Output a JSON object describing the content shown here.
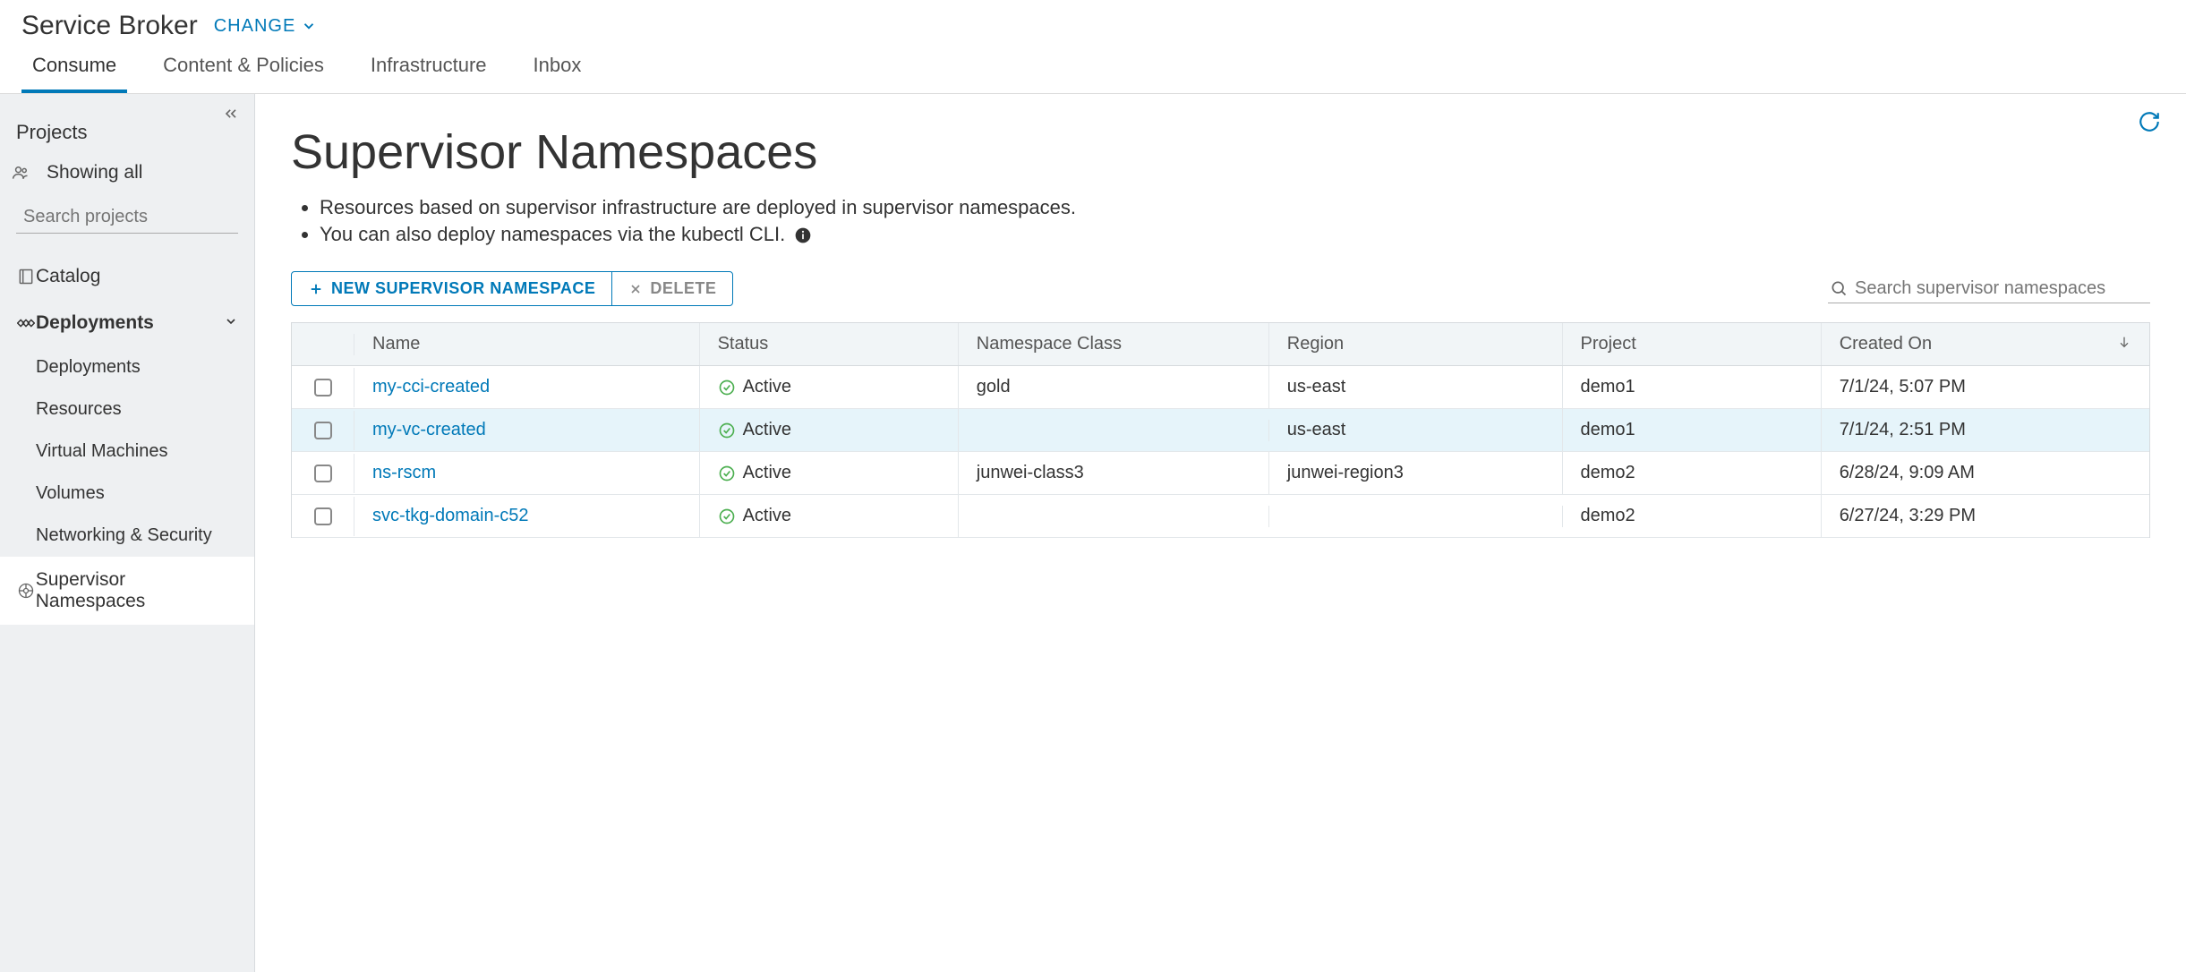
{
  "header": {
    "app_title": "Service Broker",
    "change_label": "CHANGE"
  },
  "tabs": [
    {
      "label": "Consume",
      "active": true
    },
    {
      "label": "Content & Policies",
      "active": false
    },
    {
      "label": "Infrastructure",
      "active": false
    },
    {
      "label": "Inbox",
      "active": false
    }
  ],
  "sidebar": {
    "projects_label": "Projects",
    "showing_all": "Showing all",
    "search_placeholder": "Search projects",
    "catalog": "Catalog",
    "deployments": "Deployments",
    "sub": {
      "deployments": "Deployments",
      "resources": "Resources",
      "vms": "Virtual Machines",
      "volumes": "Volumes",
      "networking": "Networking & Security"
    },
    "supervisor": "Supervisor Namespaces"
  },
  "main": {
    "title": "Supervisor Namespaces",
    "desc1": "Resources based on supervisor infrastructure are deployed in supervisor namespaces.",
    "desc2": "You can also deploy namespaces via the kubectl CLI.",
    "new_btn": "NEW SUPERVISOR NAMESPACE",
    "delete_btn": "DELETE",
    "table_search_placeholder": "Search supervisor namespaces",
    "columns": {
      "name": "Name",
      "status": "Status",
      "class": "Namespace Class",
      "region": "Region",
      "project": "Project",
      "created": "Created On"
    },
    "rows": [
      {
        "name": "my-cci-created",
        "status": "Active",
        "class": "gold",
        "region": "us-east",
        "project": "demo1",
        "created": "7/1/24, 5:07 PM",
        "highlight": false
      },
      {
        "name": "my-vc-created",
        "status": "Active",
        "class": "",
        "region": "us-east",
        "project": "demo1",
        "created": "7/1/24, 2:51 PM",
        "highlight": true
      },
      {
        "name": "ns-rscm",
        "status": "Active",
        "class": "junwei-class3",
        "region": "junwei-region3",
        "project": "demo2",
        "created": "6/28/24, 9:09 AM",
        "highlight": false
      },
      {
        "name": "svc-tkg-domain-c52",
        "status": "Active",
        "class": "",
        "region": "",
        "project": "demo2",
        "created": "6/27/24, 3:29 PM",
        "highlight": false
      }
    ]
  }
}
